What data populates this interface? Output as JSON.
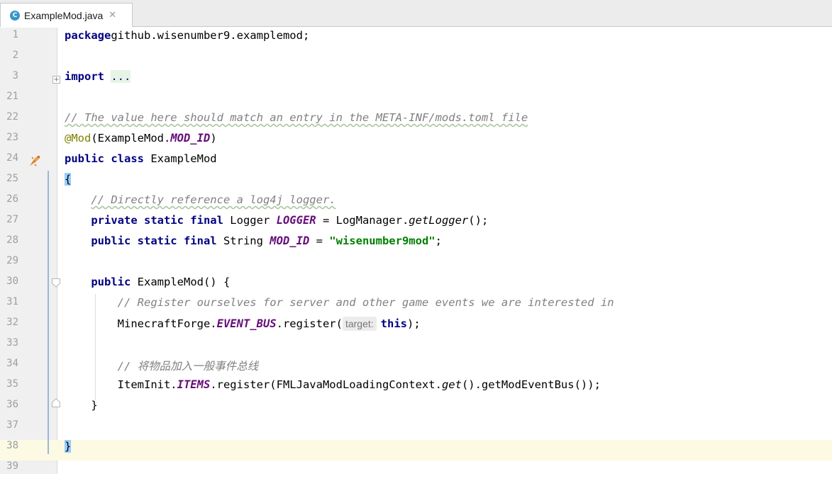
{
  "tab": {
    "file_icon_letter": "C",
    "filename": "ExampleMod.java",
    "close": "✕"
  },
  "lines": [
    {
      "num": "1",
      "parts": [
        [
          "kw",
          "package"
        ],
        [
          "",
          "github.wisenumber9.examplemod;"
        ]
      ]
    },
    {
      "num": "2",
      "parts": []
    },
    {
      "num": "3",
      "parts": [
        [
          "kw",
          "import"
        ],
        [
          "",
          " "
        ],
        [
          "fold",
          "..."
        ]
      ]
    },
    {
      "num": "21",
      "parts": []
    },
    {
      "num": "22",
      "parts": [
        [
          "cm cmw",
          "// The value here should match an entry in the META-INF/mods.toml file"
        ]
      ]
    },
    {
      "num": "23",
      "parts": [
        [
          "ann",
          "@Mod"
        ],
        [
          "",
          "(ExampleMod."
        ],
        [
          "st",
          "MOD_ID"
        ],
        [
          "",
          ")"
        ]
      ]
    },
    {
      "num": "24",
      "parts": [
        [
          "kw",
          "public class"
        ],
        [
          "",
          " ExampleMod"
        ]
      ]
    },
    {
      "num": "25",
      "parts": [
        [
          "brace",
          "{"
        ]
      ]
    },
    {
      "num": "26",
      "parts": [
        [
          "",
          "    "
        ],
        [
          "cm cmw",
          "// Directly reference a log4j logger."
        ]
      ]
    },
    {
      "num": "27",
      "parts": [
        [
          "",
          "    "
        ],
        [
          "kw",
          "private static final"
        ],
        [
          "",
          " Logger "
        ],
        [
          "st",
          "LOGGER"
        ],
        [
          "",
          " = LogManager."
        ],
        [
          "sti",
          "getLogger"
        ],
        [
          "",
          "();"
        ]
      ]
    },
    {
      "num": "28",
      "parts": [
        [
          "",
          "    "
        ],
        [
          "kw",
          "public static final"
        ],
        [
          "",
          " String "
        ],
        [
          "st",
          "MOD_ID"
        ],
        [
          "",
          " = "
        ],
        [
          "str",
          "\"wisenumber9mod\""
        ],
        [
          "",
          ";"
        ]
      ]
    },
    {
      "num": "29",
      "parts": []
    },
    {
      "num": "30",
      "parts": [
        [
          "",
          "    "
        ],
        [
          "kw",
          "public"
        ],
        [
          "",
          " ExampleMod() {"
        ]
      ]
    },
    {
      "num": "31",
      "parts": [
        [
          "",
          "        "
        ],
        [
          "cm",
          "// Register ourselves for server and other game events we are interested in"
        ]
      ]
    },
    {
      "num": "32",
      "parts": [
        [
          "",
          "        MinecraftForge."
        ],
        [
          "st",
          "EVENT_BUS"
        ],
        [
          "",
          ".register("
        ],
        [
          "hint",
          "target:"
        ],
        [
          "kw",
          "this"
        ],
        [
          "",
          ");"
        ]
      ]
    },
    {
      "num": "33",
      "parts": []
    },
    {
      "num": "34",
      "parts": [
        [
          "",
          "        "
        ],
        [
          "cm",
          "// 将物品加入一般事件总线"
        ]
      ]
    },
    {
      "num": "35",
      "parts": [
        [
          "",
          "        ItemInit."
        ],
        [
          "st",
          "ITEMS"
        ],
        [
          "",
          ".register(FMLJavaModLoadingContext."
        ],
        [
          "sti",
          "get"
        ],
        [
          "",
          "().getModEventBus());"
        ]
      ]
    },
    {
      "num": "36",
      "parts": [
        [
          "",
          "    }"
        ]
      ]
    },
    {
      "num": "37",
      "parts": []
    },
    {
      "num": "38",
      "parts": [
        [
          "brace",
          "}"
        ]
      ],
      "current": true
    },
    {
      "num": "39",
      "parts": []
    }
  ]
}
